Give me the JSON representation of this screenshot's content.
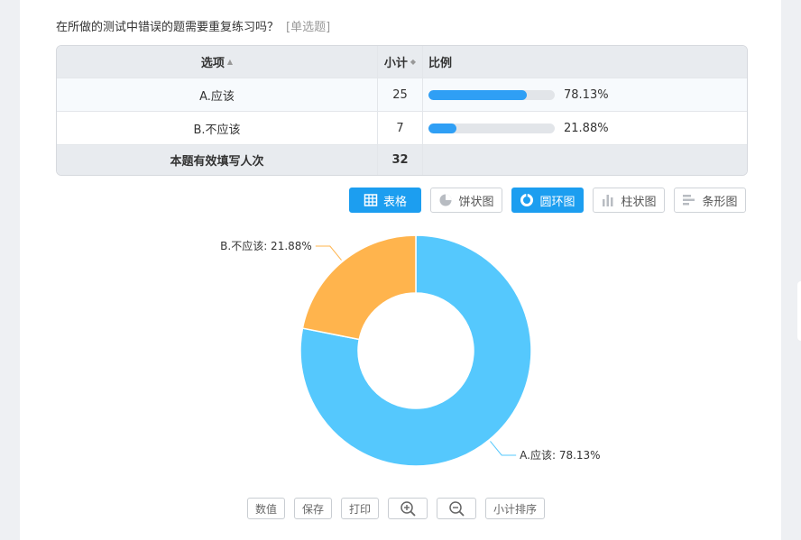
{
  "question": {
    "text": "在所做的测试中错误的题需要重复练习吗？",
    "type": "[单选题]"
  },
  "table": {
    "headers": {
      "option": "选项",
      "count": "小计",
      "ratio": "比例"
    },
    "rows": [
      {
        "option": "A.应该",
        "count": "25",
        "percent": "78.13%",
        "fraction": 0.7813
      },
      {
        "option": "B.不应该",
        "count": "7",
        "percent": "21.88%",
        "fraction": 0.2188
      }
    ],
    "total": {
      "label": "本题有效填写人次",
      "count": "32"
    }
  },
  "view_buttons": [
    {
      "label": "表格",
      "icon": "table-icon",
      "active": true
    },
    {
      "label": "饼状图",
      "icon": "pie-chart-icon",
      "active": false
    },
    {
      "label": "圆环图",
      "icon": "donut-chart-icon",
      "active": true
    },
    {
      "label": "柱状图",
      "icon": "bar-chart-icon",
      "active": false
    },
    {
      "label": "条形图",
      "icon": "horizontal-bar-chart-icon",
      "active": false
    }
  ],
  "chart_data": {
    "type": "pie",
    "variant": "donut",
    "slices": [
      {
        "label": "A.应该: 78.13%",
        "value": 78.13,
        "color": "#55c8fd"
      },
      {
        "label": "B.不应该: 21.88%",
        "value": 21.88,
        "color": "#ffb44d"
      }
    ]
  },
  "bottom_buttons": {
    "values": "数值",
    "save": "保存",
    "print": "打印",
    "zoom_in": "zoom-in-icon",
    "zoom_out": "zoom-out-icon",
    "sort": "小计排序"
  },
  "colors": {
    "accent": "#1c9ef0",
    "bar": "#2f9ff5"
  }
}
